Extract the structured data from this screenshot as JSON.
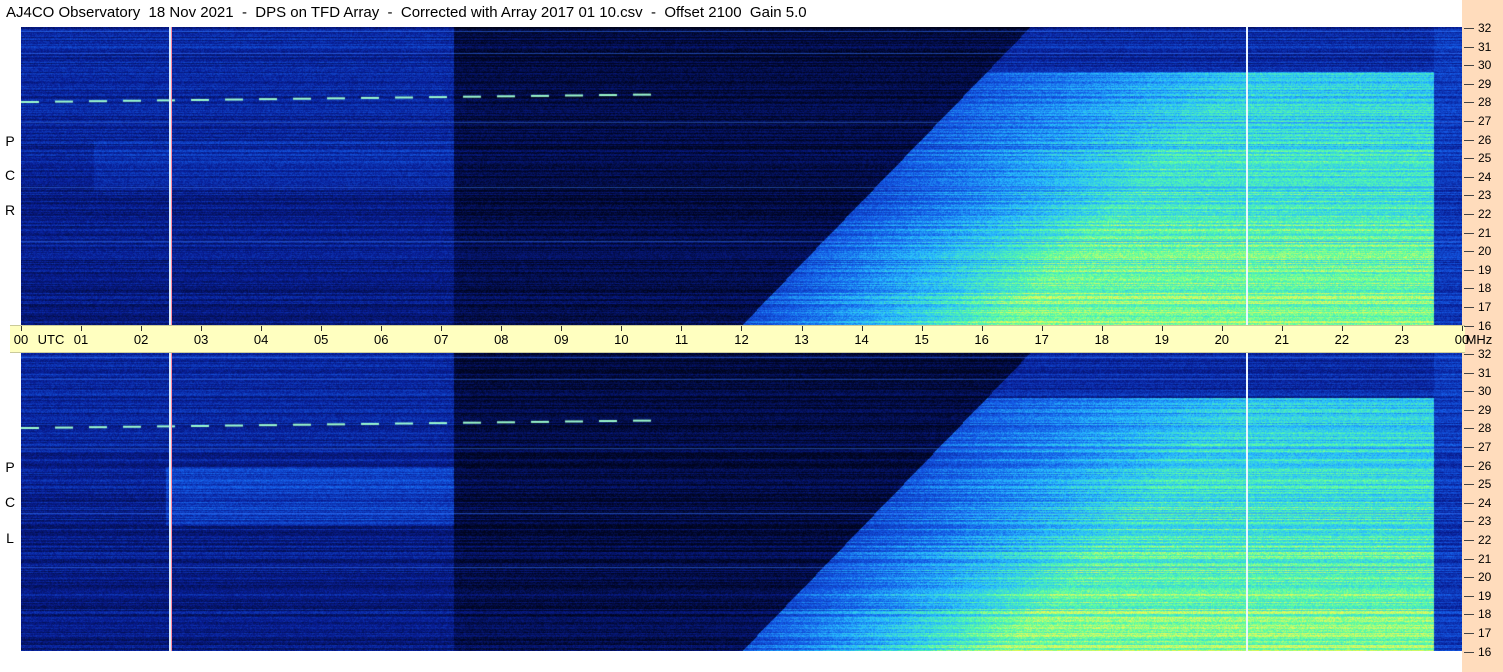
{
  "window": {
    "title": "AJ4CO Observatory  18 Nov 2021  -  DPS on TFD Array  -  Corrected with Array 2017 01 10.csv  -  Offset 2100  Gain 5.0"
  },
  "polarizations": {
    "top": [
      "R",
      "C",
      "P"
    ],
    "bottom": [
      "L",
      "C",
      "P"
    ]
  },
  "time_axis": {
    "labels": [
      "00",
      "UTC",
      "01",
      "02",
      "03",
      "04",
      "05",
      "06",
      "07",
      "08",
      "09",
      "10",
      "11",
      "12",
      "13",
      "14",
      "15",
      "16",
      "17",
      "18",
      "19",
      "20",
      "21",
      "22",
      "23",
      "00",
      "MHz"
    ]
  },
  "freq_axis": {
    "labels": [
      "32",
      "31",
      "30",
      "29",
      "28",
      "27",
      "26",
      "25",
      "24",
      "23",
      "22",
      "21",
      "20",
      "19",
      "18",
      "17",
      "16"
    ]
  },
  "colors": {
    "background_deep": "#00041e",
    "background_blue": "#0a2aa8",
    "cyan": "#30c8ff",
    "green": "#60ff90",
    "yellow": "#fff060",
    "axis_band": "#ffffc0",
    "right_strip": "#ffdcbc"
  }
}
